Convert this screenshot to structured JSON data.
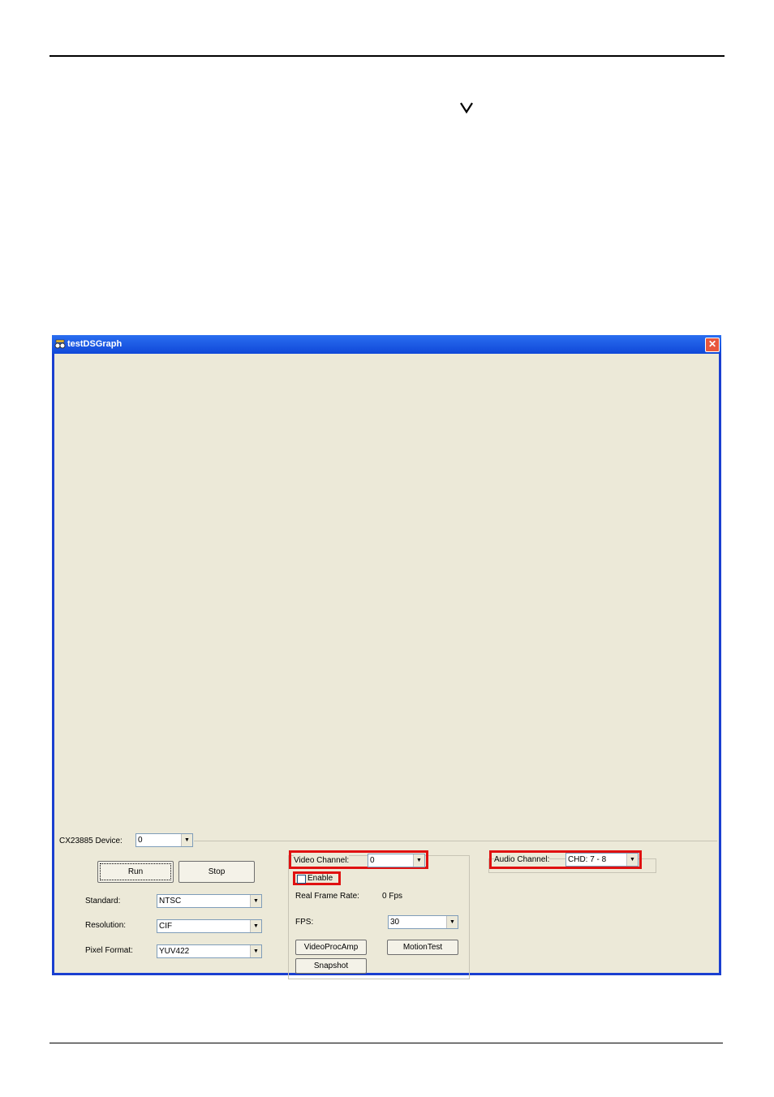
{
  "window": {
    "title": "testDSGraph",
    "close_glyph": "✕",
    "icon": "app-icon"
  },
  "device": {
    "label": "CX23885 Device:",
    "value": "0"
  },
  "buttons": {
    "run": "Run",
    "stop": "Stop",
    "videoprocamp": "VideoProcAmp",
    "motiontest": "MotionTest",
    "snapshot": "Snapshot"
  },
  "form": {
    "standard_label": "Standard:",
    "standard_value": "NTSC",
    "resolution_label": "Resolution:",
    "resolution_value": "CIF",
    "pixel_label": "Pixel Format:",
    "pixel_value": "YUV422"
  },
  "video": {
    "channel_label": "Video Channel:",
    "channel_value": "0",
    "enable_label": "Enable",
    "frame_rate_label": "Real Frame Rate:",
    "frame_rate_value": "0 Fps",
    "fps_label": "FPS:",
    "fps_value": "30"
  },
  "audio": {
    "channel_label": "Audio Channel:",
    "channel_value": "CHD: 7 - 8"
  },
  "colors": {
    "highlight": "#e01010",
    "titlebar": "#1f5ae6",
    "dialog_bg": "#ece9d8"
  }
}
